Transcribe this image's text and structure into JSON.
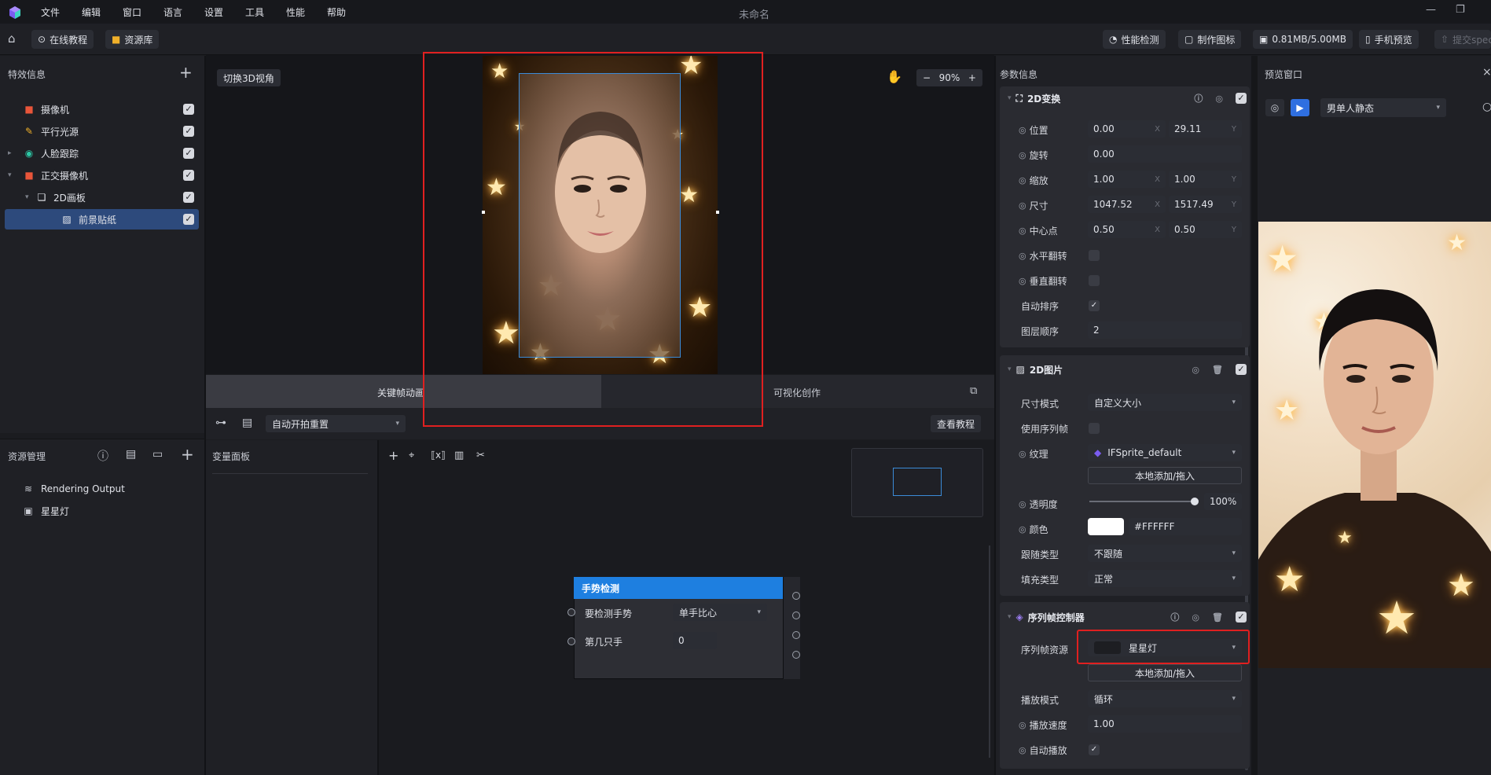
{
  "menu": {
    "items": [
      "文件",
      "编辑",
      "窗口",
      "语言",
      "设置",
      "工具",
      "性能",
      "帮助"
    ],
    "title": "未命名"
  },
  "toolbar": {
    "online_tutorial": "在线教程",
    "asset_library": "资源库",
    "perf_check": "性能检测",
    "make_icon": "制作图标",
    "size": "0.81MB/5.00MB",
    "phone_preview": "手机预览",
    "submit": "提交special"
  },
  "effects": {
    "title": "特效信息",
    "items": [
      {
        "label": "摄像机",
        "icon": "camera-icon",
        "color": "#e8553a"
      },
      {
        "label": "平行光源",
        "icon": "light-icon",
        "color": "#f0b02a"
      },
      {
        "label": "人脸跟踪",
        "icon": "face-track-icon",
        "color": "#2cc7a5"
      },
      {
        "label": "正交摄像机",
        "icon": "camera-icon",
        "color": "#e8553a"
      },
      {
        "label": "2D画板",
        "icon": "board-icon",
        "color": "#e6e8ee"
      },
      {
        "label": "前景贴纸",
        "icon": "sticker-icon",
        "color": "#e6e8ee"
      }
    ]
  },
  "viewport": {
    "toggle_3d": "切换3D视角",
    "zoom": "90%"
  },
  "view_tabs": {
    "keyframe": "关键帧动画",
    "visual": "可视化创作"
  },
  "timeline": {
    "select": "自动开拍重置",
    "tutorial": "查看教程"
  },
  "resources": {
    "title": "资源管理",
    "items": [
      {
        "label": "Rendering Output",
        "icon": "rendering-output-icon"
      },
      {
        "label": "星星灯",
        "icon": "image-asset-icon"
      }
    ]
  },
  "variables": {
    "title": "变量面板"
  },
  "node": {
    "title": "手势检测",
    "rows": [
      {
        "label": "要检测手势",
        "value": "单手比心"
      },
      {
        "label": "第几只手",
        "value": "0"
      }
    ]
  },
  "params": {
    "title": "参数信息",
    "transform": {
      "title": "2D变换",
      "position": {
        "label": "位置",
        "x": "0.00",
        "y": "29.11"
      },
      "rotation": {
        "label": "旋转",
        "value": "0.00"
      },
      "scale": {
        "label": "缩放",
        "x": "1.00",
        "y": "1.00"
      },
      "size": {
        "label": "尺寸",
        "x": "1047.52",
        "y": "1517.49"
      },
      "pivot": {
        "label": "中心点",
        "x": "0.50",
        "y": "0.50"
      },
      "flip_h": {
        "label": "水平翻转",
        "checked": false
      },
      "flip_v": {
        "label": "垂直翻转",
        "checked": false
      },
      "auto_sort": {
        "label": "自动排序",
        "checked": true
      },
      "layer_order": {
        "label": "图层顺序",
        "value": "2"
      },
      "x_suffix": "X",
      "y_suffix": "Y"
    },
    "image": {
      "title": "2D图片",
      "size_mode": {
        "label": "尺寸模式",
        "value": "自定义大小"
      },
      "use_seq": {
        "label": "使用序列帧",
        "checked": false
      },
      "texture": {
        "label": "纹理",
        "value": "IFSprite_default"
      },
      "add_local": "本地添加/拖入",
      "opacity": {
        "label": "透明度",
        "value": "100%",
        "level": 1.0
      },
      "color": {
        "label": "颜色",
        "value": "#FFFFFF",
        "swatch": "#ffffff"
      },
      "follow_type": {
        "label": "跟随类型",
        "value": "不跟随"
      },
      "fill_type": {
        "label": "填充类型",
        "value": "正常"
      }
    },
    "sequence": {
      "title": "序列帧控制器",
      "resource": {
        "label": "序列帧资源",
        "value": "星星灯"
      },
      "add_local": "本地添加/拖入",
      "play_mode": {
        "label": "播放模式",
        "value": "循环"
      },
      "speed": {
        "label": "播放速度",
        "value": "1.00"
      },
      "autoplay": {
        "label": "自动播放",
        "checked": true
      }
    }
  },
  "preview": {
    "title": "预览窗口",
    "select": "男单人静态"
  },
  "colors": {
    "accent": "#1e7fe0",
    "selected_row": "#2d4a7c",
    "highlight": "#e02020"
  }
}
